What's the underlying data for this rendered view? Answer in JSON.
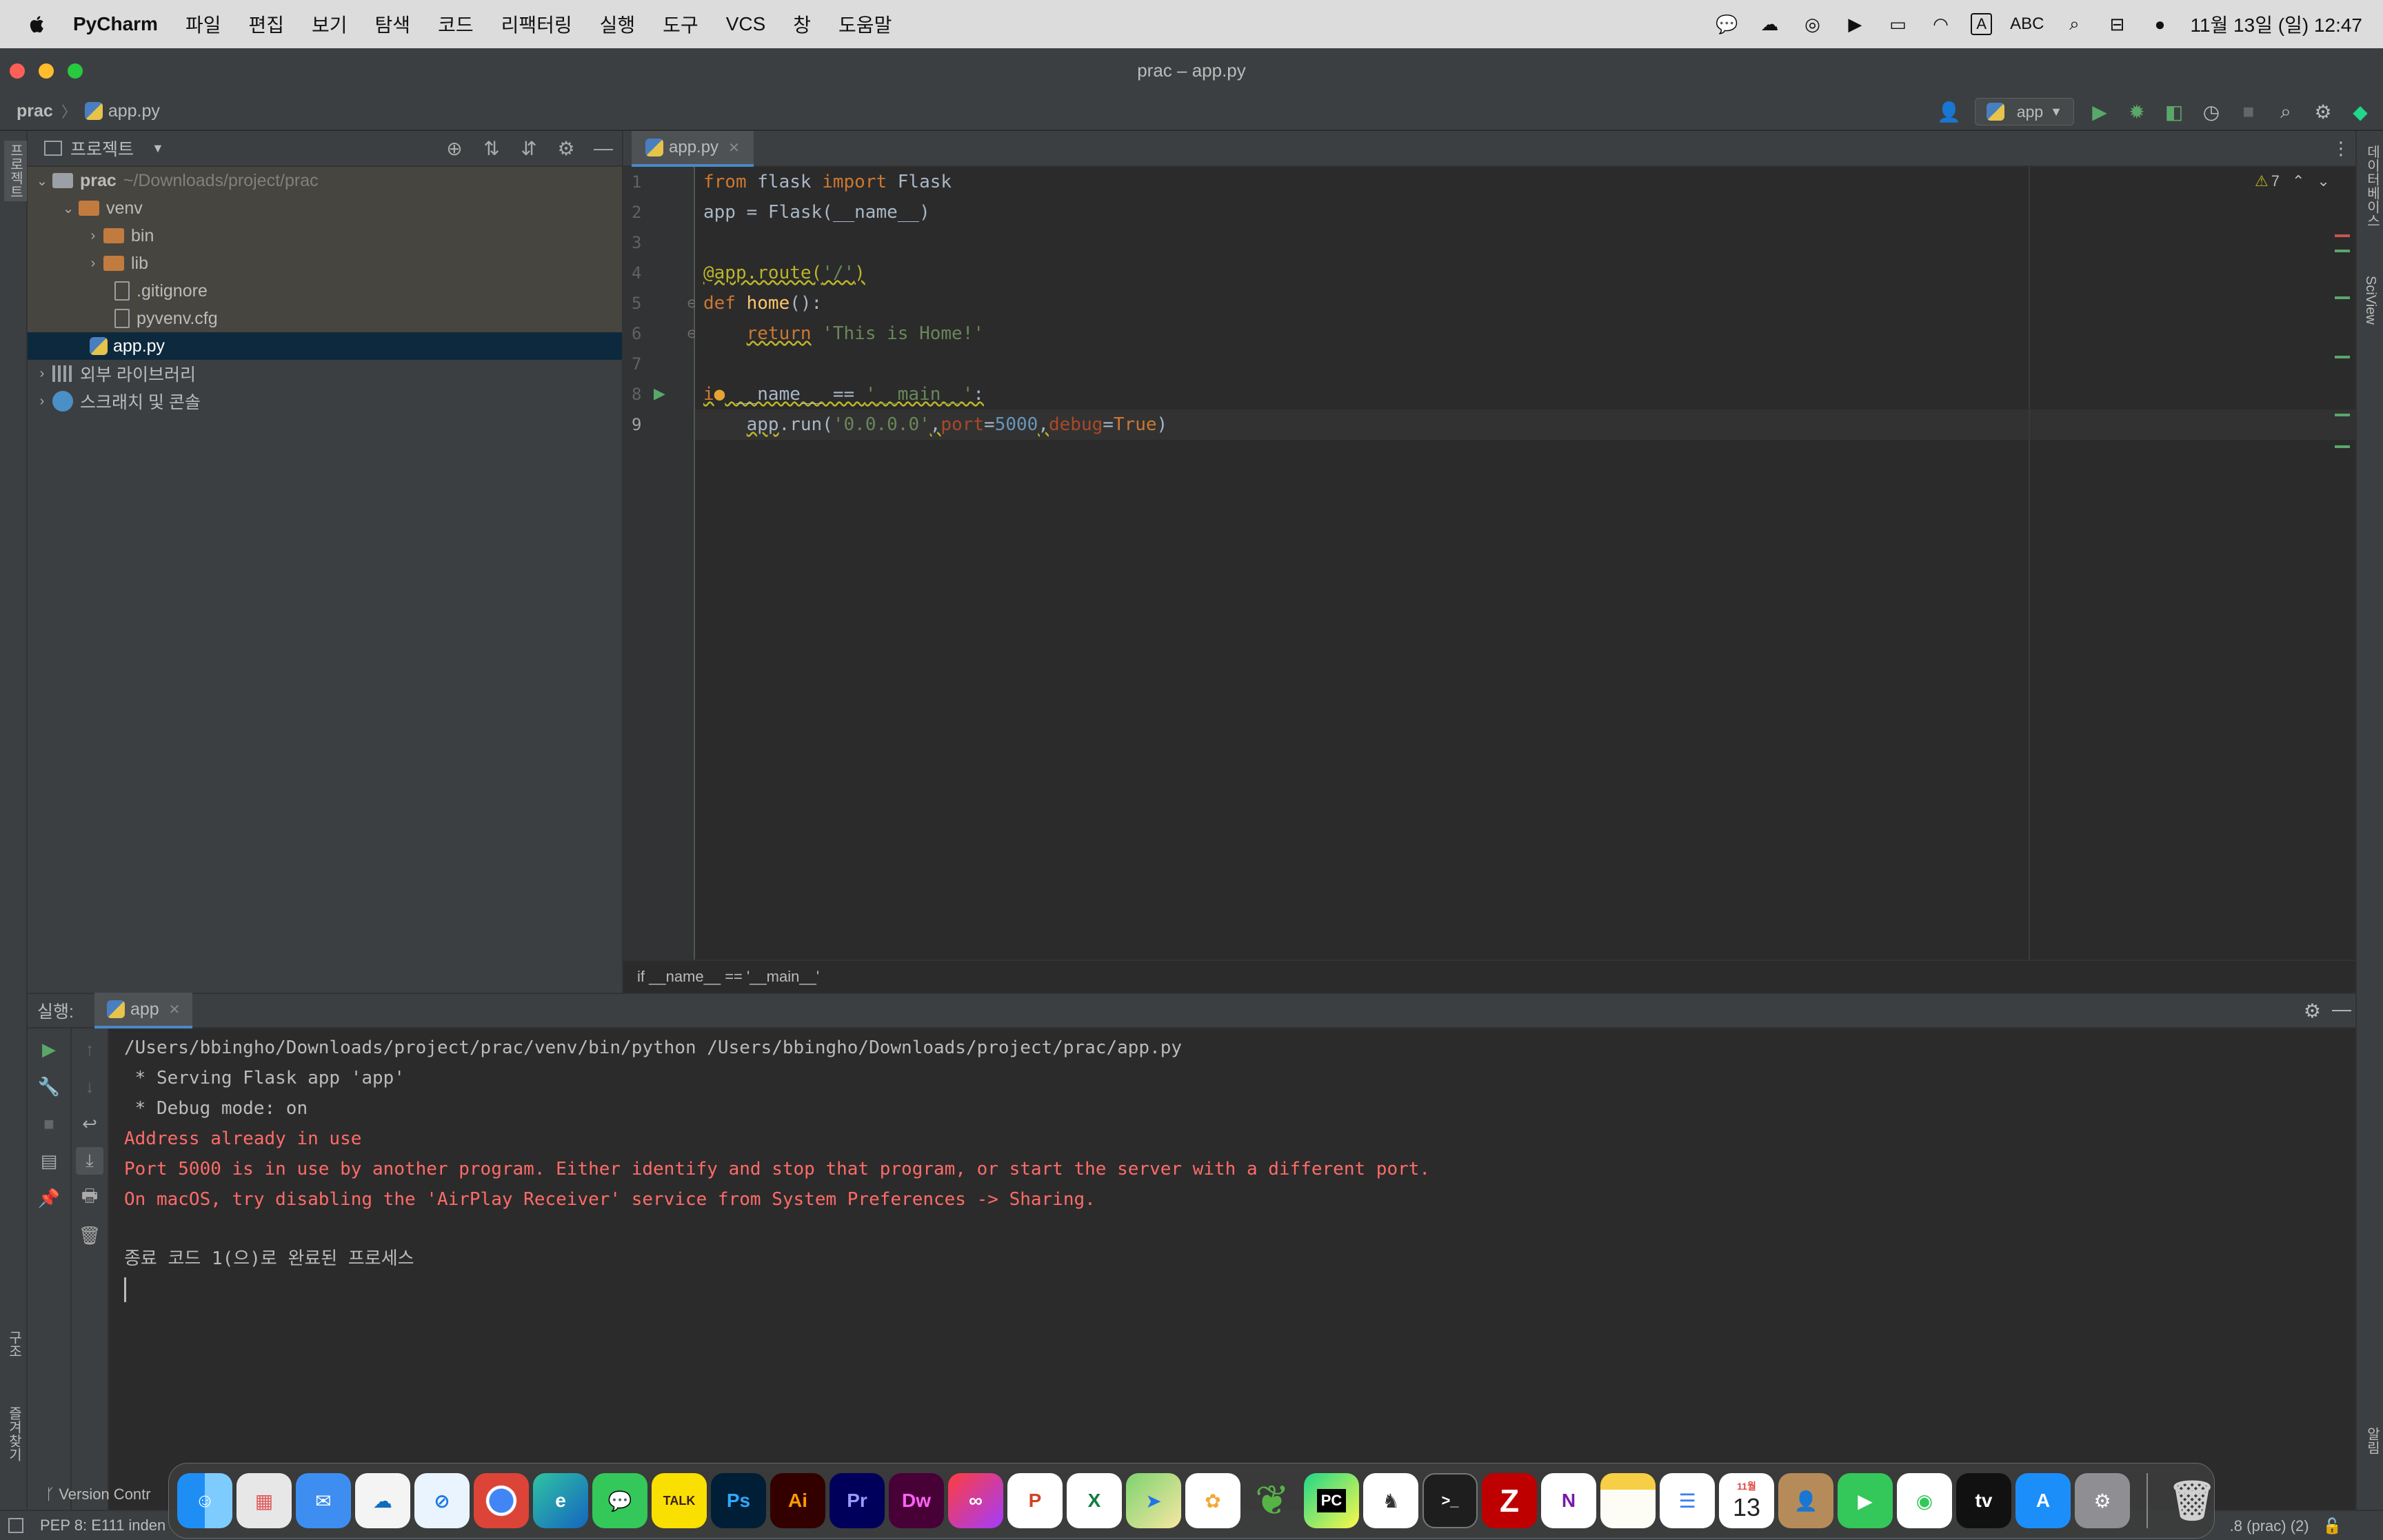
{
  "menubar": {
    "app_name": "PyCharm",
    "items": [
      "파일",
      "편집",
      "보기",
      "탐색",
      "코드",
      "리팩터링",
      "실행",
      "도구",
      "VCS",
      "창",
      "도움말"
    ],
    "input_source": "A",
    "input_label": "ABC",
    "clock": "11월 13일 (일) 12:47"
  },
  "window": {
    "title": "prac – app.py"
  },
  "navbar": {
    "project": "prac",
    "file": "app.py",
    "run_config": "app"
  },
  "project_panel": {
    "title": "프로젝트",
    "root_name": "prac",
    "root_path": "~/Downloads/project/prac",
    "items": {
      "venv": "venv",
      "bin": "bin",
      "lib": "lib",
      "gitignore": ".gitignore",
      "pyvenv": "pyvenv.cfg",
      "app": "app.py",
      "external": "외부 라이브러리",
      "scratches": "스크래치 및 콘솔"
    }
  },
  "editor": {
    "tab": "app.py",
    "line_numbers": [
      "1",
      "2",
      "3",
      "4",
      "5",
      "6",
      "7",
      "8",
      "9"
    ],
    "inspection_count": "7",
    "breadcrumb": "if __name__ == '__main__'"
  },
  "left_strip": {
    "project": "프로젝트",
    "structure": "구조",
    "favorites": "즐겨찾기"
  },
  "right_strip": {
    "database": "데이터베이스",
    "sciview": "SciView",
    "notifications": "알림"
  },
  "run_panel": {
    "label": "실행:",
    "tab": "app",
    "lines": [
      "/Users/bbingho/Downloads/project/prac/venv/bin/python /Users/bbingho/Downloads/project/prac/app.py",
      " * Serving Flask app 'app'",
      " * Debug mode: on"
    ],
    "errors": [
      "Address already in use",
      "Port 5000 is in use by another program. Either identify and stop that program, or start the server with a different port.",
      "On macOS, try disabling the 'AirPlay Receiver' service from System Preferences -> Sharing."
    ],
    "exit": "종료 코드 1(으)로 완료된 프로세스"
  },
  "statusbar": {
    "vcs": "Version Contr",
    "pep": "PEP 8: E111 inden",
    "interpreter": ".8 (prac) (2)"
  },
  "dock": {
    "ps": "Ps",
    "ai": "Ai",
    "pr": "Pr",
    "dw": "Dw",
    "talk": "TALK",
    "pc": "PC",
    "tv": "tv",
    "cal_day": "13",
    "cal_month": "11월"
  },
  "colors": {
    "keyword": "#cc7832",
    "string": "#6a8759",
    "number": "#6897bb",
    "error": "#ff6b68",
    "selection": "#0d293e",
    "accent": "#4a88c7"
  }
}
